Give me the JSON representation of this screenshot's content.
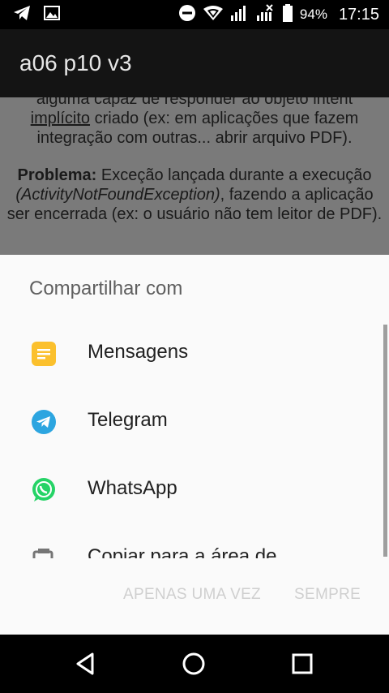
{
  "status_bar": {
    "battery_percent": "94%",
    "time": "17:15",
    "icons": [
      "telegram-icon",
      "image-icon",
      "do-not-disturb-icon",
      "wifi-icon",
      "signal-icon",
      "signal-no-data-icon",
      "battery-icon"
    ]
  },
  "app_bar": {
    "title": "a06 p10 v3"
  },
  "background_content": {
    "para1_line1": "alguma capaz de responder ao objeto intent",
    "para1_word_underlined": "implícito",
    "para1_rest": " criado (ex: em aplicações que fazem integração com outras... abrir arquivo PDF).",
    "para2_label": "Problema:",
    "para2_text1": " Exceção lançada durante a execução ",
    "para2_italic": "(ActivityNotFoundException)",
    "para2_text2": ", fazendo a aplicação ser encerrada (ex: o usuário não tem leitor de PDF)."
  },
  "share_sheet": {
    "title": "Compartilhar com",
    "items": [
      {
        "label": "Mensagens",
        "icon": "messages-icon",
        "color": "#FBC02D"
      },
      {
        "label": "Telegram",
        "icon": "telegram-icon",
        "color": "#2CA5E0"
      },
      {
        "label": "WhatsApp",
        "icon": "whatsapp-icon",
        "color": "#25D366"
      },
      {
        "label": "Copiar para a área de",
        "icon": "clipboard-icon",
        "color": "#757575"
      }
    ],
    "buttons": {
      "once": "APENAS UMA VEZ",
      "always": "SEMPRE"
    }
  },
  "nav_bar": {
    "icons": [
      "back-icon",
      "home-icon",
      "recents-icon"
    ]
  }
}
